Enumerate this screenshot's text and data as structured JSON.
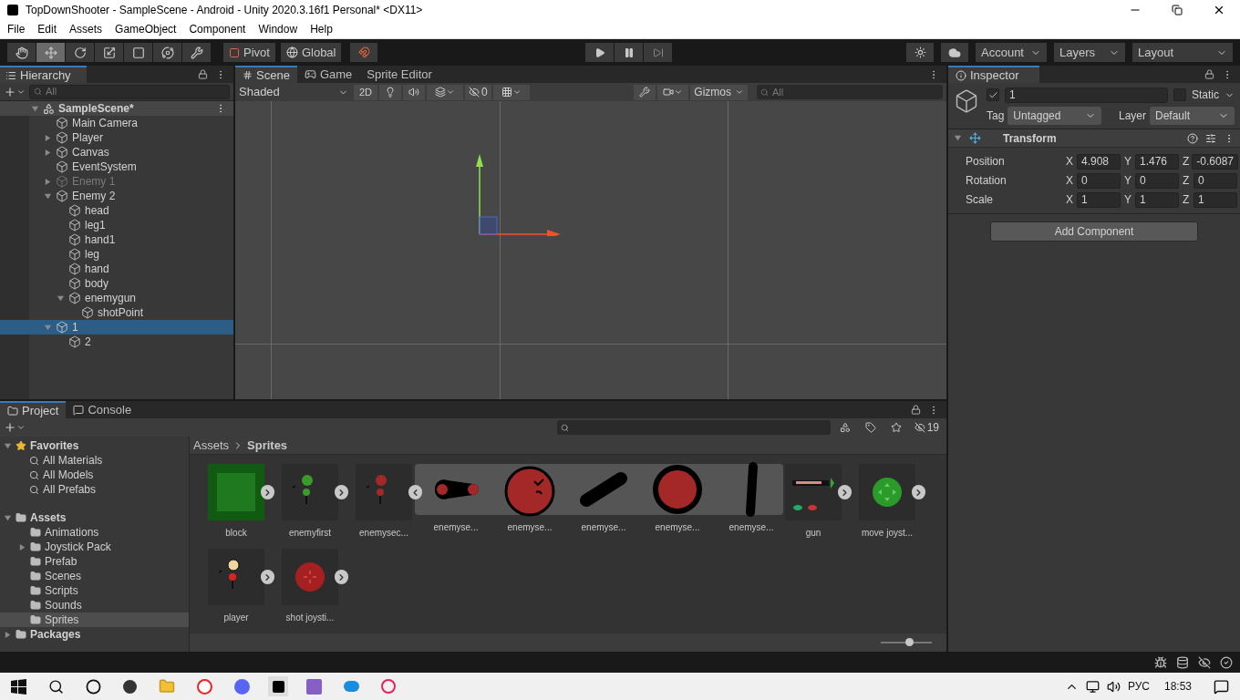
{
  "window": {
    "title": "TopDownShooter - SampleScene - Android - Unity 2020.3.16f1 Personal* <DX11>"
  },
  "menu": [
    "File",
    "Edit",
    "Assets",
    "GameObject",
    "Component",
    "Window",
    "Help"
  ],
  "toolbar": {
    "tools": [
      {
        "selected": false
      },
      {
        "selected": true
      },
      {
        "selected": false
      },
      {
        "selected": false
      },
      {
        "selected": false
      },
      {
        "selected": false
      },
      {
        "selected": false
      }
    ],
    "pivot": "Pivot",
    "global": "Global",
    "account": "Account",
    "layers": "Layers",
    "layout": "Layout"
  },
  "hierarchy": {
    "tab": "Hierarchy",
    "search_placeholder": "All",
    "scene": "SampleScene*",
    "items": [
      {
        "label": "Main Camera",
        "disabled": false,
        "selected": false
      },
      {
        "label": "Player",
        "disabled": false,
        "selected": false,
        "expanded": false
      },
      {
        "label": "Canvas",
        "disabled": false,
        "selected": false,
        "expanded": false
      },
      {
        "label": "EventSystem",
        "disabled": false,
        "selected": false
      },
      {
        "label": "Enemy 1",
        "disabled": true,
        "selected": false,
        "expanded": false
      },
      {
        "label": "Enemy 2",
        "disabled": false,
        "selected": false,
        "expanded": true,
        "children": [
          {
            "label": "head",
            "disabled": false,
            "selected": false
          },
          {
            "label": "leg1",
            "disabled": false,
            "selected": false
          },
          {
            "label": "hand1",
            "disabled": false,
            "selected": false
          },
          {
            "label": "leg",
            "disabled": false,
            "selected": false
          },
          {
            "label": "hand",
            "disabled": false,
            "selected": false
          },
          {
            "label": "body",
            "disabled": false,
            "selected": false
          },
          {
            "label": "enemygun",
            "disabled": false,
            "selected": false,
            "expanded": true,
            "children": [
              {
                "label": "shotPoint",
                "disabled": false,
                "selected": false
              }
            ]
          }
        ]
      },
      {
        "label": "1",
        "disabled": false,
        "selected": true,
        "expanded": true,
        "children": [
          {
            "label": "2",
            "disabled": false,
            "selected": false
          }
        ]
      }
    ]
  },
  "scene_view": {
    "tabs": [
      {
        "label": "Scene",
        "selected": true
      },
      {
        "label": "Game",
        "selected": false
      },
      {
        "label": "Sprite Editor",
        "selected": false
      }
    ],
    "shading": "Shaded",
    "mode_2d": "2D",
    "hidden_count": "0",
    "gizmos": "Gizmos",
    "search_placeholder": "All"
  },
  "inspector": {
    "tab": "Inspector",
    "active": true,
    "name": "1",
    "static_label": "Static",
    "static": false,
    "tag_label": "Tag",
    "tag": "Untagged",
    "layer_label": "Layer",
    "layer": "Default",
    "component": "Transform",
    "rows": [
      {
        "label": "Position",
        "fields": [
          {
            "axis": "X",
            "value": "4.908"
          },
          {
            "axis": "Y",
            "value": "1.476"
          },
          {
            "axis": "Z",
            "value": "-0.6087"
          }
        ]
      },
      {
        "label": "Rotation",
        "fields": [
          {
            "axis": "X",
            "value": "0"
          },
          {
            "axis": "Y",
            "value": "0"
          },
          {
            "axis": "Z",
            "value": "0"
          }
        ]
      },
      {
        "label": "Scale",
        "fields": [
          {
            "axis": "X",
            "value": "1"
          },
          {
            "axis": "Y",
            "value": "1"
          },
          {
            "axis": "Z",
            "value": "1"
          }
        ]
      }
    ],
    "add_component": "Add Component"
  },
  "project": {
    "tabs": [
      {
        "label": "Project",
        "selected": true
      },
      {
        "label": "Console",
        "selected": false
      }
    ],
    "hidden_count": "19",
    "favorites": {
      "label": "Favorites",
      "items": [
        "All Materials",
        "All Models",
        "All Prefabs"
      ]
    },
    "assets": {
      "label": "Assets",
      "children": [
        {
          "label": "Animations",
          "selected": false,
          "expandable": false
        },
        {
          "label": "Joystick Pack",
          "selected": false,
          "expandable": true
        },
        {
          "label": "Prefab",
          "selected": false,
          "expandable": false
        },
        {
          "label": "Scenes",
          "selected": false,
          "expandable": false
        },
        {
          "label": "Scripts",
          "selected": false,
          "expandable": false
        },
        {
          "label": "Sounds",
          "selected": false,
          "expandable": false
        },
        {
          "label": "Sprites",
          "selected": true,
          "expandable": false
        }
      ]
    },
    "packages": "Packages",
    "breadcrumb": [
      "Assets",
      "Sprites"
    ],
    "files": [
      {
        "name": "block",
        "expanded": false
      },
      {
        "name": "enemyfirst",
        "expanded": false
      },
      {
        "name": "enemysec...",
        "expanded": true,
        "children": [
          "enemyse...",
          "enemyse...",
          "enemyse...",
          "enemyse...",
          "enemyse..."
        ]
      },
      {
        "name": "gun",
        "expanded": false
      },
      {
        "name": "move joyst...",
        "expanded": false
      },
      {
        "name": "player",
        "expanded": false
      },
      {
        "name": "shot joysti...",
        "expanded": false
      }
    ],
    "zoom": {
      "level": 0.56
    }
  },
  "taskbar": {
    "language": "РУС",
    "time": "18:53"
  }
}
